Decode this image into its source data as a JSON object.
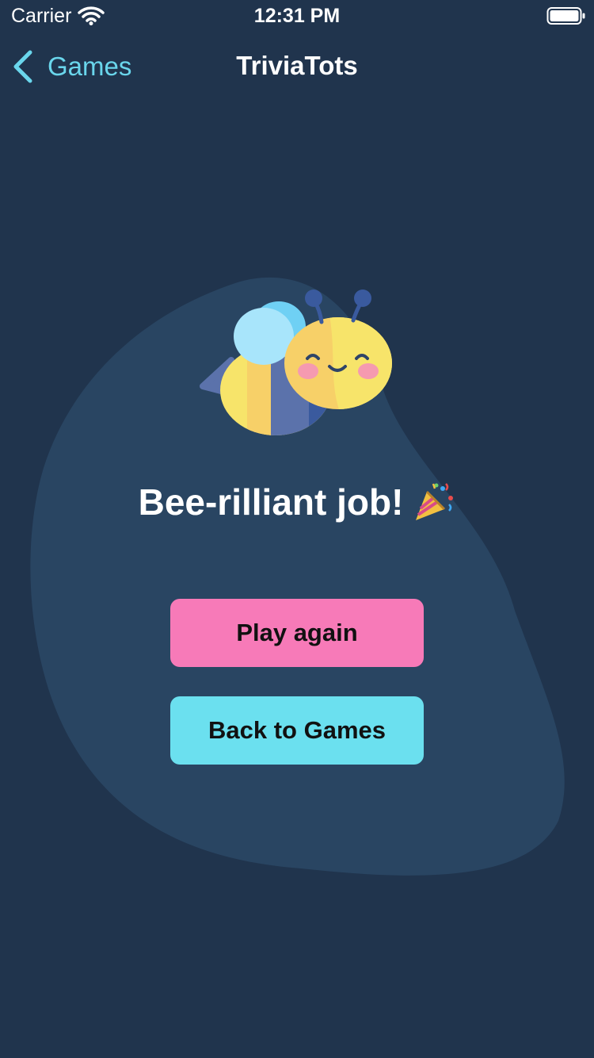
{
  "status_bar": {
    "carrier": "Carrier",
    "time": "12:31 PM",
    "icons": [
      "wifi-icon",
      "battery-icon"
    ]
  },
  "nav": {
    "back_label": "Games",
    "title": "TriviaTots",
    "back_icon": "chevron-left-icon"
  },
  "result": {
    "message": "Bee-rilliant job!",
    "emoji_icon": "party-popper-icon",
    "illustration": "bee-icon"
  },
  "actions": {
    "play_again_label": "Play again",
    "back_to_games_label": "Back to Games"
  },
  "colors": {
    "background": "#20344d",
    "blob": "#294562",
    "accent": "#6ad6ec",
    "play_button": "#f77ab8",
    "back_button": "#6be0ef"
  }
}
